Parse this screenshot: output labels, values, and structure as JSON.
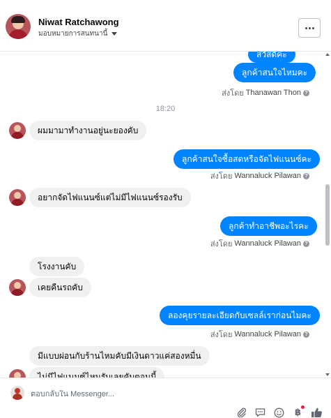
{
  "header": {
    "name": "Niwat Ratchawong",
    "assign_label": "มอบหมายการสนทนานี้"
  },
  "thread": {
    "time_divider": "18:20",
    "messages": [
      {
        "side": "out",
        "text": "ลูกค้าสนใจไหมคะ"
      },
      {
        "side": "sentby",
        "label": "ส่งโดย",
        "agent": "Thanawan Thon"
      },
      {
        "side": "in",
        "text": "ผมมามาทำงานอยู่นะยองคับ"
      },
      {
        "side": "out",
        "text": "ลูกค้าสนใจซื้อสดหรือจัดไฟแนนซ์คะ"
      },
      {
        "side": "sentby",
        "label": "ส่งโดย",
        "agent": "Wannaluck Pilawan"
      },
      {
        "side": "in",
        "text": "อยากจัดไฟแนนซ์แต่ไม่มีไฟแนนซ์รองรับ"
      },
      {
        "side": "out",
        "text": "ลูกค้าทำอาชีพอะไรคะ"
      },
      {
        "side": "sentby",
        "label": "ส่งโดย",
        "agent": "Wannaluck Pilawan"
      },
      {
        "side": "in",
        "text": "โรงงานคับ"
      },
      {
        "side": "in",
        "text": "เคยคืนรถคับ"
      },
      {
        "side": "out",
        "text": "ลองคุยรายละเอียดกับเซลล์เราก่อนไมคะ"
      },
      {
        "side": "sentby",
        "label": "ส่งโดย",
        "agent": "Wannaluck Pilawan"
      },
      {
        "side": "in",
        "text": "มีแบบผ่อนกับร้านไหมคับมีเงินดาวแค่สองหมื่น"
      },
      {
        "side": "in",
        "text": "ไม่มีไฟแนนซ์ไหนรับเลยคับตอนนี้"
      }
    ],
    "partial_top_text": "สวัสดีค่ะ"
  },
  "composer": {
    "placeholder": "ตอบกลับใน Messenger..."
  },
  "colors": {
    "outgoing_bubble": "#0084ff",
    "incoming_bubble": "#f0f0f0",
    "notification_dot": "#e41e3f"
  },
  "icons": [
    "paperclip-icon",
    "saved-reply-icon",
    "emoji-icon",
    "payment-icon",
    "like-icon"
  ]
}
